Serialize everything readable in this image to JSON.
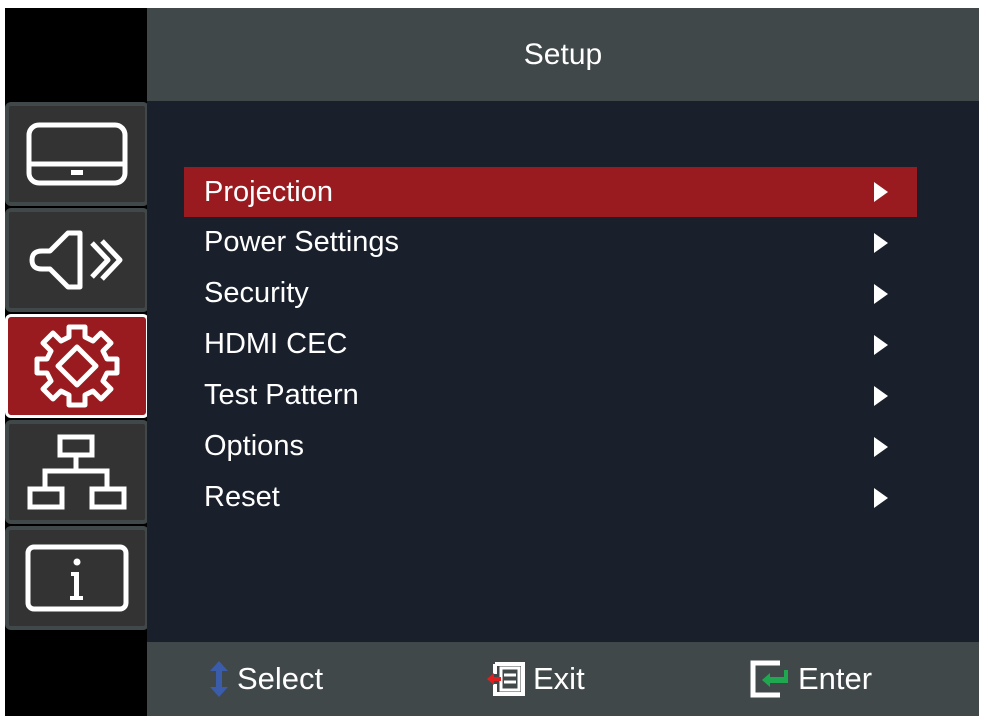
{
  "header": {
    "title": "Setup"
  },
  "sidebar": {
    "items": [
      {
        "name": "display",
        "icon": "display-icon",
        "active": false
      },
      {
        "name": "audio",
        "icon": "speaker-icon",
        "active": false
      },
      {
        "name": "setup",
        "icon": "gear-icon",
        "active": true
      },
      {
        "name": "network",
        "icon": "network-icon",
        "active": false
      },
      {
        "name": "information",
        "icon": "info-icon",
        "active": false
      }
    ]
  },
  "menu": {
    "items": [
      {
        "label": "Projection",
        "selected": true,
        "icon": "chevron-right-icon"
      },
      {
        "label": "Power Settings",
        "selected": false,
        "icon": "chevron-right-icon"
      },
      {
        "label": "Security",
        "selected": false,
        "icon": "chevron-right-icon"
      },
      {
        "label": "HDMI CEC",
        "selected": false,
        "icon": "chevron-right-icon"
      },
      {
        "label": "Test Pattern",
        "selected": false,
        "icon": "chevron-right-icon"
      },
      {
        "label": "Options",
        "selected": false,
        "icon": "chevron-right-icon"
      },
      {
        "label": "Reset",
        "selected": false,
        "icon": "chevron-right-icon"
      }
    ]
  },
  "footer": {
    "select_label": "Select",
    "exit_label": "Exit",
    "enter_label": "Enter"
  },
  "colors": {
    "accent": "#9a1b1f",
    "header_bg": "#41484a",
    "main_bg": "#19202b",
    "select_icon": "#3b5bab",
    "exit_icon": "#e02020",
    "enter_icon": "#1fa84f"
  }
}
